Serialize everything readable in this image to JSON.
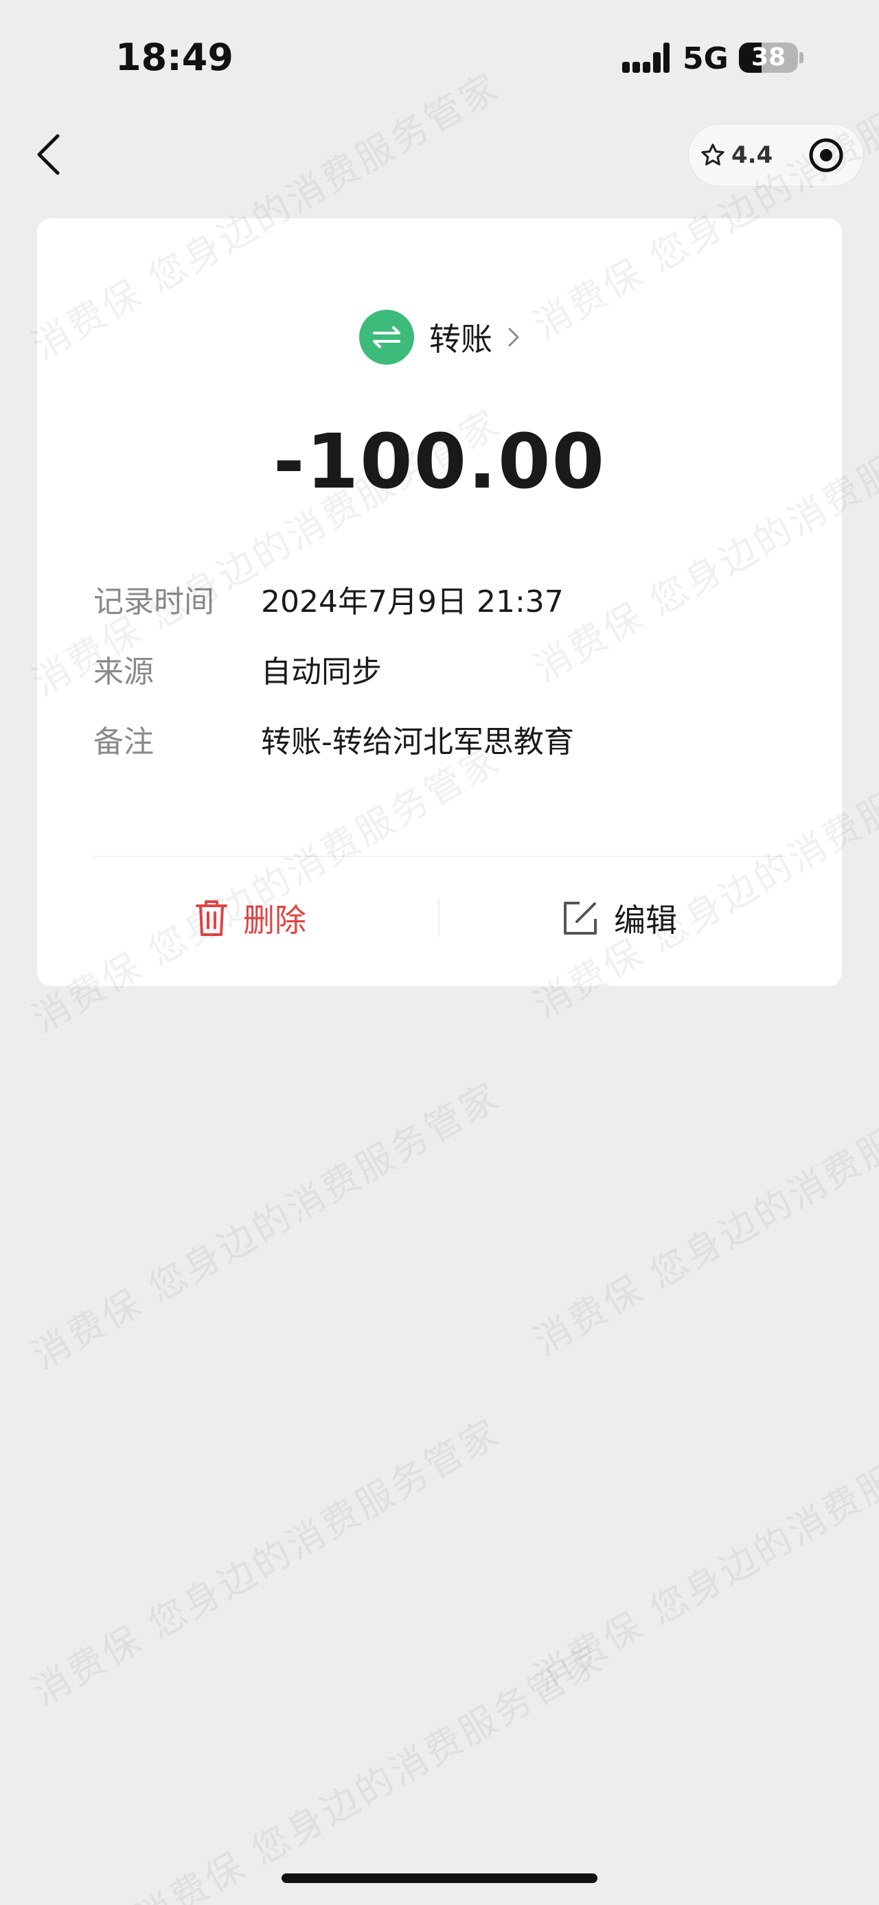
{
  "status_bar": {
    "time": "18:49",
    "network": "5G",
    "battery_level": "38",
    "battery_fraction": 0.38
  },
  "nav": {
    "back_icon": "chevron-left-icon",
    "rating": "4.4",
    "rating_icon": "star-outline-icon",
    "capsule_icon": "target-icon"
  },
  "record": {
    "category": "转账",
    "category_icon": "transfer-arrows-icon",
    "category_color": "#3dbb7a",
    "amount": "-100.00",
    "fields": [
      {
        "label": "记录时间",
        "value": "2024年7月9日 21:37"
      },
      {
        "label": "来源",
        "value": "自动同步"
      },
      {
        "label": "备注",
        "value": "转账-转给河北军思教育"
      }
    ]
  },
  "actions": {
    "delete_label": "删除",
    "delete_color": "#e04444",
    "edit_label": "编辑"
  },
  "watermark": {
    "text": "消费保 您身边的消费服务管家"
  }
}
